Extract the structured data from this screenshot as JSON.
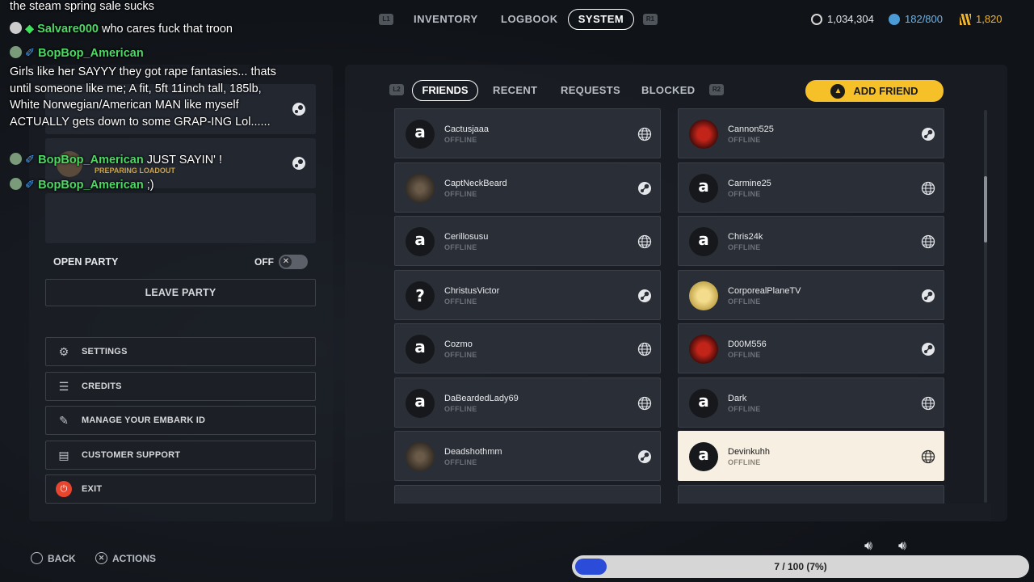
{
  "nav": {
    "l1": "L1",
    "r1": "R1",
    "inventory": "INVENTORY",
    "logbook": "LOGBOOK",
    "system": "SYSTEM"
  },
  "currency": {
    "coins": "1,034,304",
    "storage": "182/800",
    "tokens": "1,820",
    "colors": {
      "coins": "#d8d8d8",
      "storage": "#4a9bd6",
      "tokens": "#f0b429"
    }
  },
  "party": {
    "member_status": "PREPARING LOADOUT",
    "open_party_label": "OPEN PARTY",
    "open_party_value": "OFF",
    "leave_label": "LEAVE PARTY"
  },
  "menu": {
    "settings": "SETTINGS",
    "credits": "CREDITS",
    "embark": "MANAGE YOUR EMBARK ID",
    "support": "CUSTOMER SUPPORT",
    "exit": "EXIT"
  },
  "friends_tabs": {
    "l2": "L2",
    "r2": "R2",
    "friends": "FRIENDS",
    "recent": "RECENT",
    "requests": "REQUESTS",
    "blocked": "BLOCKED",
    "add_friend": "ADD FRIEND"
  },
  "friends": [
    {
      "name": "Cactusjaaa",
      "status": "OFFLINE",
      "avatar": "embark",
      "platform": "globe-icon"
    },
    {
      "name": "Cannon525",
      "status": "OFFLINE",
      "avatar": "red",
      "platform": "steam-icon"
    },
    {
      "name": "CaptNeckBeard",
      "status": "OFFLINE",
      "avatar": "photo",
      "platform": "steam-icon"
    },
    {
      "name": "Carmine25",
      "status": "OFFLINE",
      "avatar": "embark",
      "platform": "globe-icon"
    },
    {
      "name": "Cerillosusu",
      "status": "OFFLINE",
      "avatar": "embark",
      "platform": "globe-icon"
    },
    {
      "name": "Chris24k",
      "status": "OFFLINE",
      "avatar": "embark",
      "platform": "globe-icon"
    },
    {
      "name": "ChristusVictor",
      "status": "OFFLINE",
      "avatar": "question",
      "platform": "steam-icon"
    },
    {
      "name": "CorporealPlaneTV",
      "status": "OFFLINE",
      "avatar": "yellow",
      "platform": "steam-icon"
    },
    {
      "name": "Cozmo",
      "status": "OFFLINE",
      "avatar": "embark",
      "platform": "globe-icon"
    },
    {
      "name": "D00M556",
      "status": "OFFLINE",
      "avatar": "red",
      "platform": "steam-icon"
    },
    {
      "name": "DaBeardedLady69",
      "status": "OFFLINE",
      "avatar": "embark",
      "platform": "globe-icon"
    },
    {
      "name": "Dark",
      "status": "OFFLINE",
      "avatar": "embark",
      "platform": "globe-icon"
    },
    {
      "name": "Deadshothmm",
      "status": "OFFLINE",
      "avatar": "photo",
      "platform": "steam-icon"
    },
    {
      "name": "Devinkuhh",
      "status": "OFFLINE",
      "avatar": "embark",
      "platform": "globe-icon",
      "selected": true
    }
  ],
  "chat": {
    "line0": "the steam spring sale sucks",
    "user1": "Salvare000",
    "msg1": "who cares fuck that troon",
    "user2": "BopBop_American",
    "msg2": "Girls like her SAYYY they got rape fantasies... thats until someone like me; A fit, 5ft 11inch tall, 185lb, White Norwegian/American MAN like myself ACTUALLY gets down to some GRAP-ING Lol......",
    "user3": "BopBop_American",
    "msg3": "JUST SAYIN' !",
    "user4": "BopBop_American",
    "msg4": ";)"
  },
  "footer": {
    "back": "BACK",
    "actions": "ACTIONS"
  },
  "progress": {
    "label": "7 / 100 (7%)",
    "value": 0.07
  }
}
